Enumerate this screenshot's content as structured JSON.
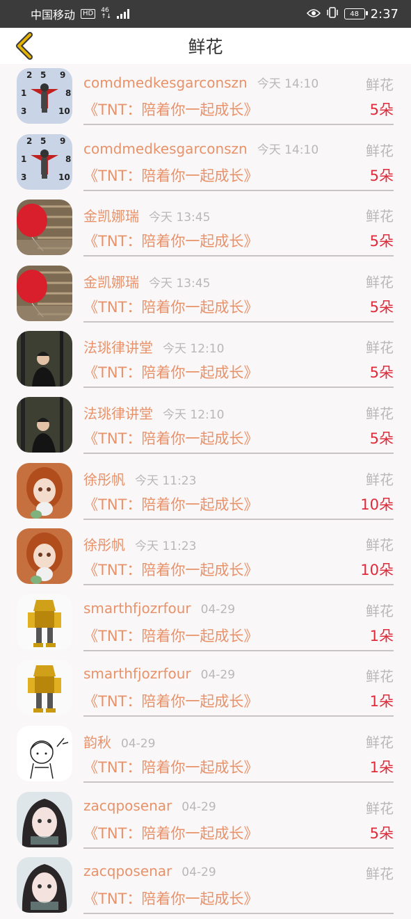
{
  "status_bar": {
    "carrier": "中国移动",
    "hd": "HD",
    "network": "46",
    "battery": "48",
    "time": "2:37"
  },
  "header": {
    "title": "鲜花",
    "back_icon": "chevron-left-icon",
    "accent": "#e6b400"
  },
  "colors": {
    "name": "#e8926a",
    "amount": "#e02a3a",
    "muted": "#b8b8b8"
  },
  "rows": [
    {
      "name": "comdmedkesgarconszn",
      "time": "今天 14:10",
      "category": "鲜花",
      "book": "《TNT：陪着你一起成长》",
      "amount": "5朵",
      "avatar": "clock-devil"
    },
    {
      "name": "comdmedkesgarconszn",
      "time": "今天 14:10",
      "category": "鲜花",
      "book": "《TNT：陪着你一起成长》",
      "amount": "5朵",
      "avatar": "clock-devil"
    },
    {
      "name": "金凯娜瑞",
      "time": "今天 13:45",
      "category": "鲜花",
      "book": "《TNT：陪着你一起成长》",
      "amount": "5朵",
      "avatar": "red-balloon"
    },
    {
      "name": "金凯娜瑞",
      "time": "今天 13:45",
      "category": "鲜花",
      "book": "《TNT：陪着你一起成长》",
      "amount": "5朵",
      "avatar": "red-balloon"
    },
    {
      "name": "法珧律讲堂",
      "time": "今天 12:10",
      "category": "鲜花",
      "book": "《TNT：陪着你一起成长》",
      "amount": "5朵",
      "avatar": "forest-man"
    },
    {
      "name": "法珧律讲堂",
      "time": "今天 12:10",
      "category": "鲜花",
      "book": "《TNT：陪着你一起成长》",
      "amount": "5朵",
      "avatar": "forest-man"
    },
    {
      "name": "徐彤帆",
      "time": "今天 11:23",
      "category": "鲜花",
      "book": "《TNT：陪着你一起成长》",
      "amount": "10朵",
      "avatar": "doll"
    },
    {
      "name": "徐彤帆",
      "time": "今天 11:23",
      "category": "鲜花",
      "book": "《TNT：陪着你一起成长》",
      "amount": "10朵",
      "avatar": "doll"
    },
    {
      "name": "smarthfjozrfour",
      "time": "04-29",
      "category": "鲜花",
      "book": "《TNT：陪着你一起成长》",
      "amount": "1朵",
      "avatar": "robot"
    },
    {
      "name": "smarthfjozrfour",
      "time": "04-29",
      "category": "鲜花",
      "book": "《TNT：陪着你一起成长》",
      "amount": "1朵",
      "avatar": "robot"
    },
    {
      "name": "韵秋",
      "time": "04-29",
      "category": "鲜花",
      "book": "《TNT：陪着你一起成长》",
      "amount": "1朵",
      "avatar": "sketch-girl"
    },
    {
      "name": "zacqposenar",
      "time": "04-29",
      "category": "鲜花",
      "book": "《TNT：陪着你一起成长》",
      "amount": "5朵",
      "avatar": "anime-girl"
    },
    {
      "name": "zacqposenar",
      "time": "04-29",
      "category": "鲜花",
      "book": "《TNT：陪着你一起成长》",
      "amount": "",
      "avatar": "anime-girl"
    }
  ]
}
